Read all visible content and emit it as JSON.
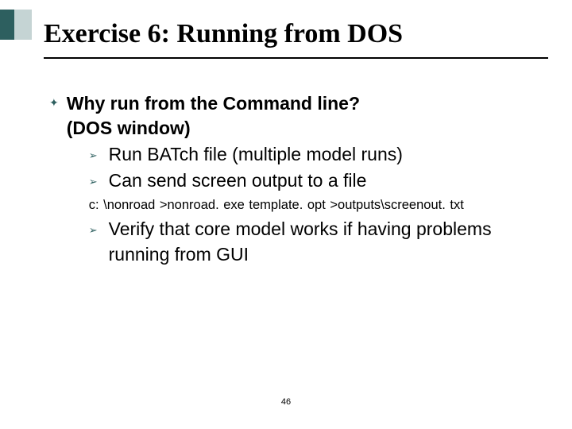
{
  "title": "Exercise 6: Running from DOS",
  "bullet_glyph": "✦",
  "sub_glyph": "➢",
  "main": {
    "line1": "Why run from the Command line?",
    "line2": "(DOS window)"
  },
  "subs": {
    "a": "Run BATch file (multiple model runs)",
    "b": "Can send screen output to a file",
    "c": "Verify that core model works if having problems running from GUI"
  },
  "code": "c: \\nonroad >nonroad. exe  template. opt  >outputs\\screenout. txt",
  "page": "46"
}
